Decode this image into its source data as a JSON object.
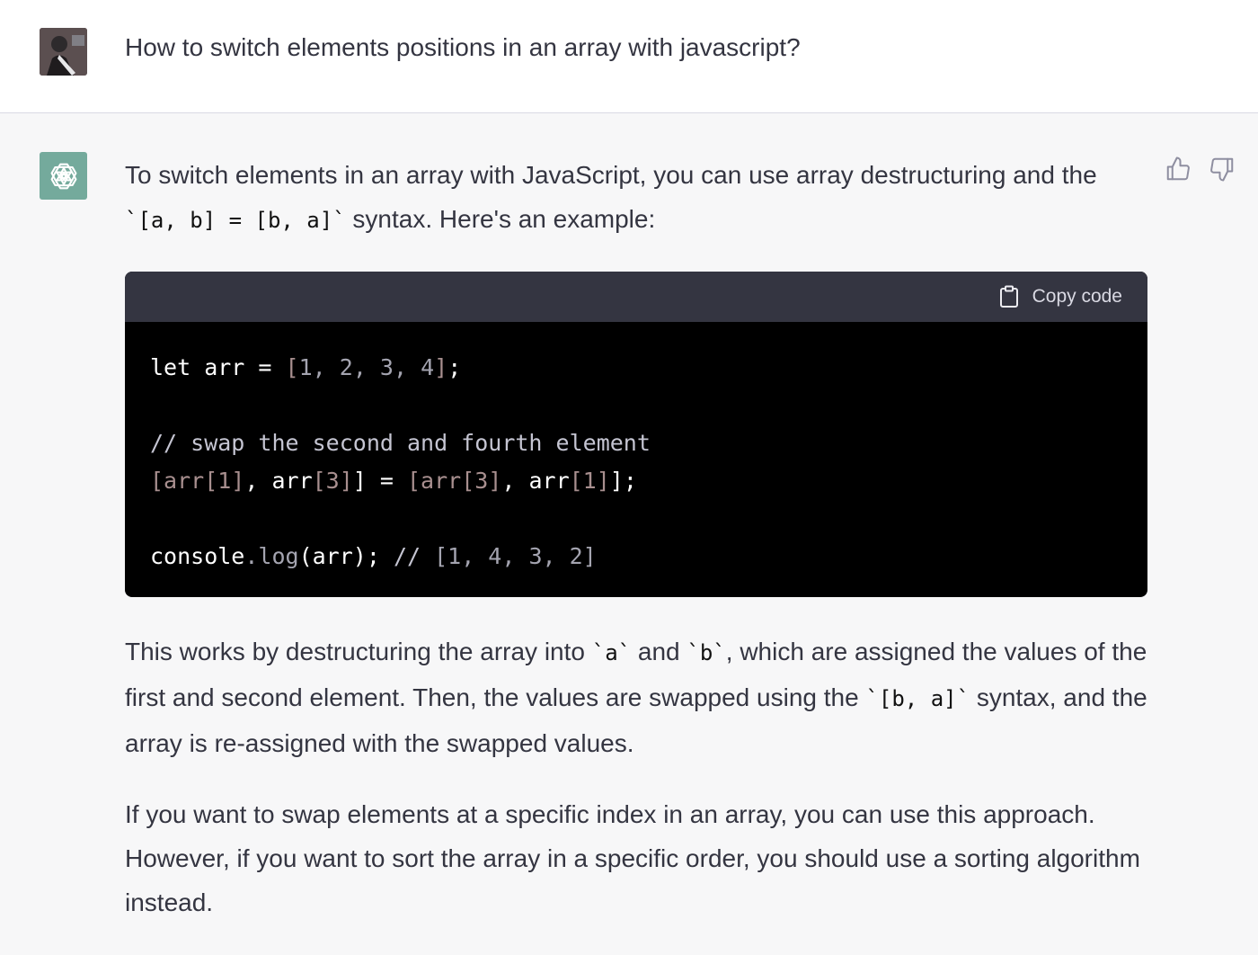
{
  "user": {
    "question": "How to switch elements positions in an array with javascript?"
  },
  "assistant": {
    "intro_part1": "To switch elements in an array with JavaScript, you can use array destructuring and the",
    "intro_code": "`[a, b] = [b, a]`",
    "intro_part2": " syntax. Here's an example:",
    "code_block": {
      "copy_label": "Copy code",
      "lines": [
        "let arr = [1, 2, 3, 4];",
        "",
        "// swap the second and fourth element",
        "[arr[1], arr[3]] = [arr[3], arr[1]];",
        "",
        "console.log(arr); // [1, 4, 3, 2]"
      ]
    },
    "explanation": {
      "t1": "This works by destructuring the array into ",
      "c1": "`a`",
      "t2": " and ",
      "c2": "`b`",
      "t3": ", which are assigned the values of the first and second element. Then, the values are swapped using the ",
      "c3": "`[b, a]`",
      "t4": " syntax, and the array is re-assigned with the swapped values."
    },
    "closing": "If you want to swap elements at a specific index in an array, you can use this approach. However, if you want to sort the array in a specific order, you should use a sorting algorithm instead."
  },
  "icons": [
    "user-avatar",
    "openai-logo-icon",
    "thumbs-up-icon",
    "thumbs-down-icon",
    "clipboard-icon"
  ],
  "colors": {
    "assistant_bg": "#f7f7f8",
    "user_bg": "#ffffff",
    "gpt_icon_bg": "#74aa9c",
    "code_header_bg": "#343541",
    "code_bg": "#000000"
  }
}
